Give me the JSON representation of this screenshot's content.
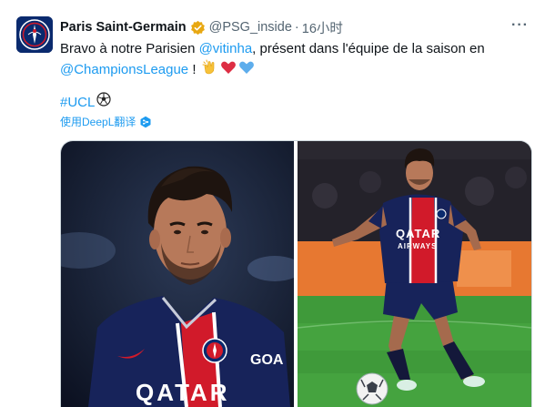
{
  "tweet": {
    "author": "Paris Saint-Germain",
    "handle": "@PSG_inside",
    "separator": "·",
    "time": "16小时",
    "more": "···",
    "text_before": "Bravo à notre Parisien ",
    "mention_1": "@vitinha",
    "text_middle": ", présent dans l'équipe de la saison en ",
    "mention_2": "@ChampionsLeague",
    "text_after": " !",
    "hashtag": "#UCL",
    "translate_label": "使用DeepL翻译"
  },
  "media": {
    "jersey_sponsor_left": "QATAR",
    "jersey_sponsor_right_line1": "QATAR",
    "jersey_sponsor_right_line2": "AIRWAYS",
    "shirt_partner": "GOA"
  },
  "colors": {
    "accent": "#1d9bf0",
    "psg_navy": "#0a2a6e",
    "psg_red": "#d11a2a",
    "verified_gold": "#e8a812"
  },
  "icons": {
    "verified": "verified-gold-badge-icon",
    "more": "more-icon",
    "ball": "soccer-ball-icon",
    "translate": "deepl-translate-icon",
    "emojis": [
      "clapping-hands-icon",
      "red-heart-icon",
      "blue-heart-icon"
    ]
  }
}
